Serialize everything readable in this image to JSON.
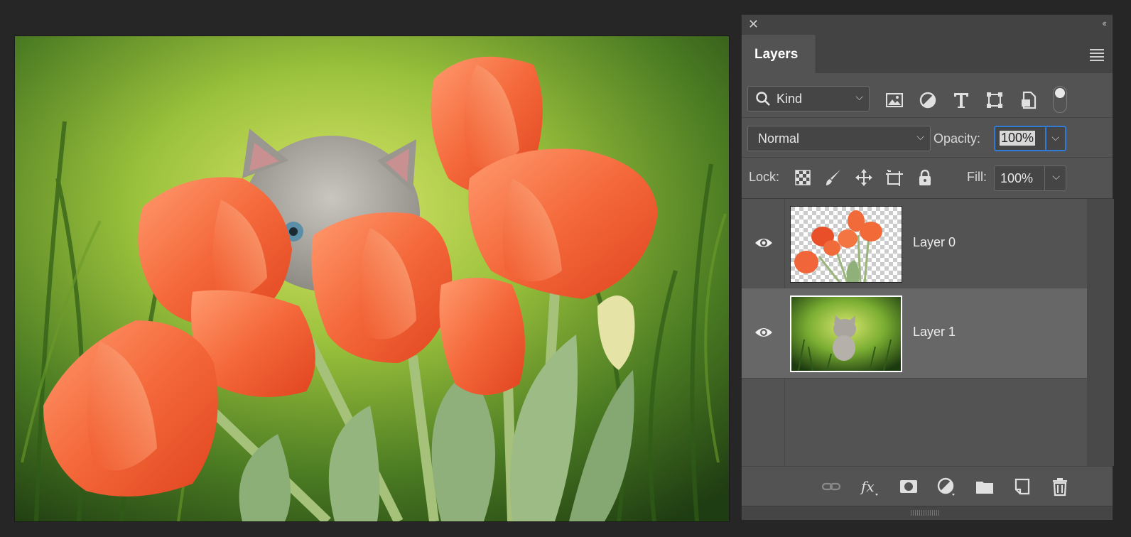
{
  "panel": {
    "title": "Layers",
    "filter": {
      "kind_label": "Kind"
    },
    "blend_mode": "Normal",
    "opacity_label": "Opacity:",
    "opacity_value": "100%",
    "lock_label": "Lock:",
    "fill_label": "Fill:",
    "fill_value": "100%",
    "layers": [
      {
        "name": "Layer 0",
        "visible": true,
        "selected": false
      },
      {
        "name": "Layer 1",
        "visible": true,
        "selected": true
      }
    ]
  },
  "icons": {
    "filter": [
      "pixel-filter-icon",
      "adjustment-filter-icon",
      "type-filter-icon",
      "shape-filter-icon",
      "smart-object-filter-icon"
    ],
    "lock": [
      "lock-transparency-icon",
      "lock-paint-icon",
      "lock-position-icon",
      "lock-artboard-icon",
      "lock-all-icon"
    ],
    "bottom": [
      "link-layers-icon",
      "fx-icon",
      "add-mask-icon",
      "new-adjustment-icon",
      "new-group-icon",
      "new-layer-icon",
      "delete-layer-icon"
    ]
  },
  "colors": {
    "accent": "#2f7bd5",
    "panel_bg": "#535353",
    "selected_row": "#676767"
  }
}
